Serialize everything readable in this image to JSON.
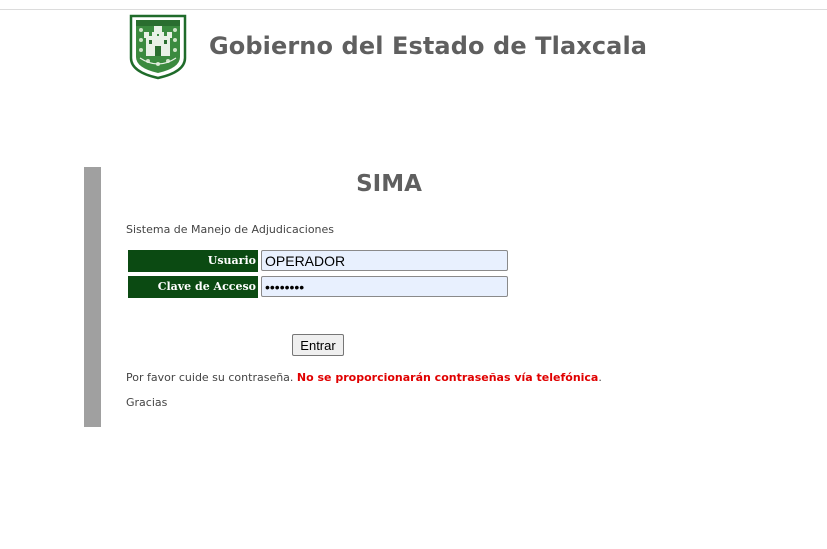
{
  "header": {
    "title": "Gobierno del Estado de Tlaxcala",
    "crest_icon": "tlaxcala-coat-of-arms-icon"
  },
  "app": {
    "title": "SIMA",
    "subtitle": "Sistema de Manejo de Adjudicaciones"
  },
  "login": {
    "user_label": "Usuario",
    "user_value": "OPERADOR",
    "password_label": "Clave de Acceso",
    "password_value": "12345678",
    "submit_label": "Entrar"
  },
  "notice": {
    "lead": "Por favor cuide su contraseña. ",
    "warning": "No se proporcionarán contraseñas vía telefónica",
    "tail": ".",
    "thanks": "Gracias"
  },
  "colors": {
    "label_background": "#0b4a12",
    "title_gray": "#5f5f5f",
    "warning_red": "#e00000",
    "sidebar_gray": "#a0a0a0",
    "input_autofill": "#e8f0fe"
  }
}
